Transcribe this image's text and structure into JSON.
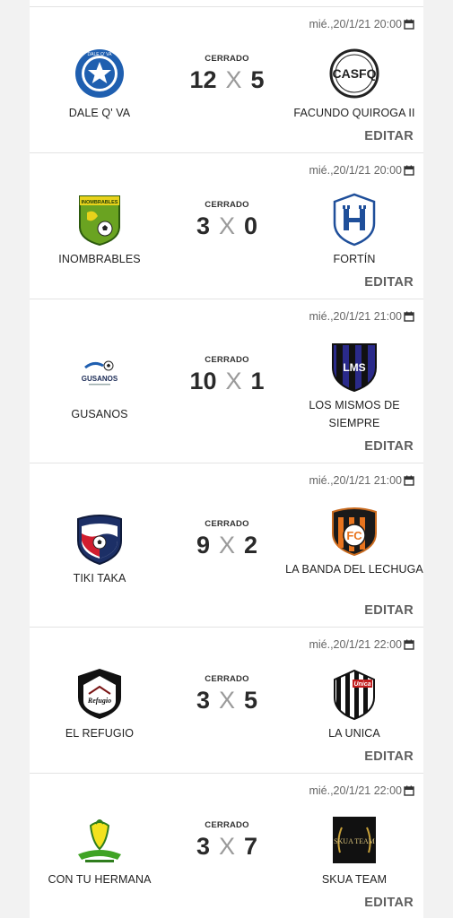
{
  "matches": [
    {
      "date": "mié.,20/1/21 20:00",
      "status": "CERRADO",
      "home": {
        "name": "DALE Q' VA",
        "logo": "dale-q-va-crest-icon",
        "score": "12"
      },
      "away": {
        "name": "FACUNDO QUIROGA II",
        "logo": "facundo-quiroga-crest-icon",
        "score": "5"
      },
      "edit_label": "EDITAR"
    },
    {
      "date": "mié.,20/1/21 20:00",
      "status": "CERRADO",
      "home": {
        "name": "INOMBRABLES",
        "logo": "inombrables-crest-icon",
        "score": "3"
      },
      "away": {
        "name": "FORTÍN",
        "logo": "fortin-crest-icon",
        "score": "0"
      },
      "edit_label": "EDITAR"
    },
    {
      "date": "mié.,20/1/21 21:00",
      "status": "CERRADO",
      "home": {
        "name": "GUSANOS",
        "logo": "gusanos-crest-icon",
        "score": "10"
      },
      "away": {
        "name": "LOS MISMOS DE SIEMPRE",
        "logo": "los-mismos-crest-icon",
        "score": "1"
      },
      "edit_label": "EDITAR"
    },
    {
      "date": "mié.,20/1/21 21:00",
      "status": "CERRADO",
      "home": {
        "name": "TIKI TAKA",
        "logo": "tiki-taka-crest-icon",
        "score": "9"
      },
      "away": {
        "name": "LA BANDA DEL LECHUGA",
        "logo": "la-banda-crest-icon",
        "score": "2"
      },
      "edit_label": "EDITAR"
    },
    {
      "date": "mié.,20/1/21 22:00",
      "status": "CERRADO",
      "home": {
        "name": "EL REFUGIO",
        "logo": "el-refugio-crest-icon",
        "score": "3"
      },
      "away": {
        "name": "LA UNICA",
        "logo": "la-unica-crest-icon",
        "score": "5"
      },
      "edit_label": "EDITAR"
    },
    {
      "date": "mié.,20/1/21 22:00",
      "status": "CERRADO",
      "home": {
        "name": "CON TU HERMANA",
        "logo": "con-tu-hermana-crest-icon",
        "score": "3"
      },
      "away": {
        "name": "SKUA TEAM",
        "logo": "skua-team-crest-icon",
        "score": "7"
      },
      "edit_label": "EDITAR"
    }
  ],
  "score_separator": "X",
  "logo_text": {
    "dale_q_va": "DALE Q' VA",
    "facundo_quiroga": "CASFQ",
    "inombrables": "INOMBRABLES",
    "gusanos": "GUSANOS",
    "los_mismos": "LMS",
    "la_banda": "FC",
    "el_refugio": "Refugio",
    "la_unica": "Unica",
    "skua_team": "SKUA TEAM"
  },
  "colors": {
    "accent_text": "#5f5f5f",
    "border": "#e3e3e3",
    "rail": "#f2f2f2"
  }
}
